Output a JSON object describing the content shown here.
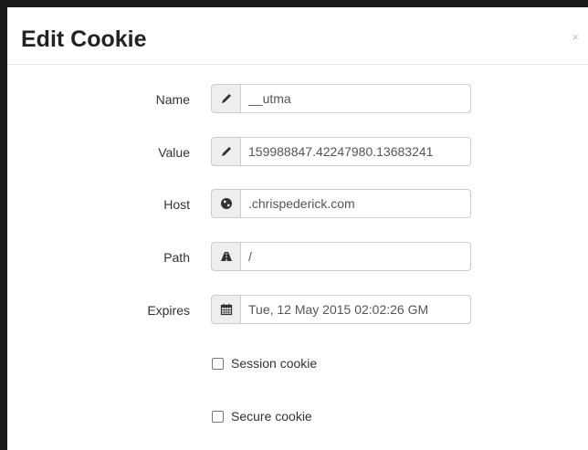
{
  "modal": {
    "title": "Edit Cookie",
    "close_label": "×"
  },
  "form": {
    "name": {
      "label": "Name",
      "value": "__utma",
      "icon": "pencil-icon"
    },
    "value": {
      "label": "Value",
      "value": "159988847.42247980.13683241",
      "icon": "pencil-icon"
    },
    "host": {
      "label": "Host",
      "value": ".chrispederick.com",
      "icon": "globe-icon"
    },
    "path": {
      "label": "Path",
      "value": "/",
      "icon": "road-icon"
    },
    "expires": {
      "label": "Expires",
      "value": "Tue, 12 May 2015 02:02:26 GM",
      "icon": "calendar-icon"
    },
    "session_cookie": {
      "label": "Session cookie",
      "checked": false
    },
    "secure_cookie": {
      "label": "Secure cookie",
      "checked": false
    }
  },
  "colors": {
    "addon_bg": "#eeeeee",
    "border": "#cccccc",
    "text": "#333333"
  }
}
